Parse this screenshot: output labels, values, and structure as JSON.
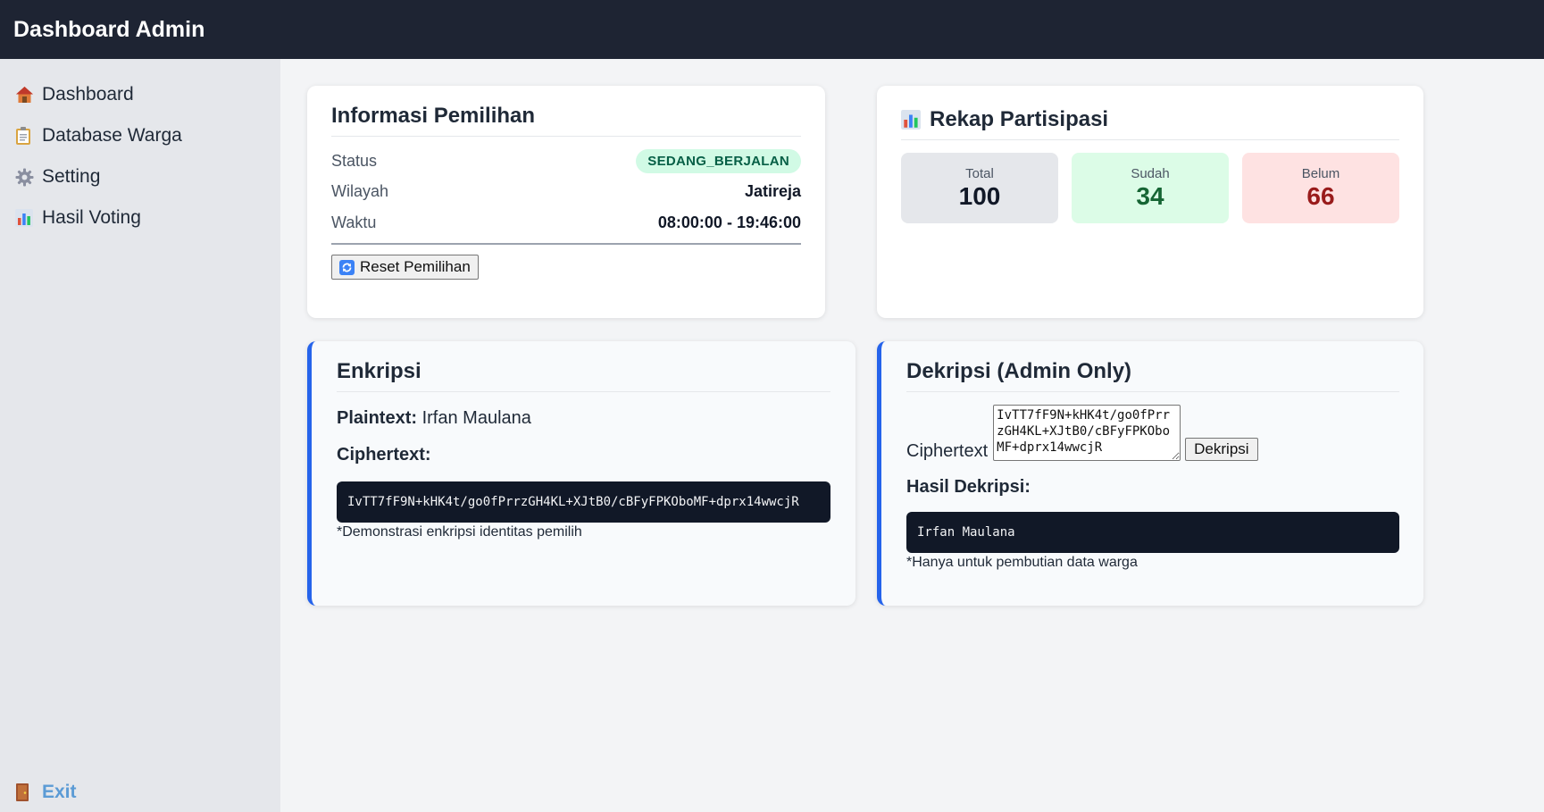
{
  "header": {
    "title": "Dashboard Admin"
  },
  "sidebar": {
    "items": [
      {
        "label": "Dashboard",
        "icon": "house-icon"
      },
      {
        "label": "Database Warga",
        "icon": "clipboard-icon"
      },
      {
        "label": "Setting",
        "icon": "gear-icon"
      },
      {
        "label": "Hasil Voting",
        "icon": "bar-chart-icon"
      }
    ],
    "exit_label": "Exit"
  },
  "info": {
    "title": "Informasi Pemilihan",
    "status_label": "Status",
    "status_value": "SEDANG_BERJALAN",
    "wilayah_label": "Wilayah",
    "wilayah_value": "Jatireja",
    "waktu_label": "Waktu",
    "waktu_value": "08:00:00 - 19:46:00",
    "reset_label": "Reset Pemilihan"
  },
  "rekap": {
    "title": "Rekap Partisipasi",
    "total_label": "Total",
    "total_value": "100",
    "sudah_label": "Sudah",
    "sudah_value": "34",
    "belum_label": "Belum",
    "belum_value": "66"
  },
  "enkripsi": {
    "title": "Enkripsi",
    "plaintext_label": "Plaintext:",
    "plaintext_value": "Irfan Maulana",
    "ciphertext_label": "Ciphertext:",
    "ciphertext_value": "IvTT7fF9N+kHK4t/go0fPrrzGH4KL+XJtB0/cBFyFPKOboMF+dprx14wwcjR",
    "note": "*Demonstrasi enkripsi identitas pemilih"
  },
  "dekripsi": {
    "title": "Dekripsi (Admin Only)",
    "ciphertext_label": "Ciphertext",
    "ciphertext_input": "IvTT7fF9N+kHK4t/go0fPrrzGH4KL+XJtB0/cBFyFPKOboMF+dprx14wwcjR",
    "button_label": "Dekripsi",
    "result_label": "Hasil Dekripsi:",
    "result_value": "Irfan Maulana",
    "note": "*Hanya untuk pembutian data warga"
  },
  "colors": {
    "topbar": "#1e2433",
    "accent": "#2563eb",
    "sudah_bg": "#dcfce7",
    "sudah_text": "#166534",
    "belum_bg": "#fee2e2",
    "belum_text": "#991b1b",
    "total_bg": "#e5e7eb"
  }
}
